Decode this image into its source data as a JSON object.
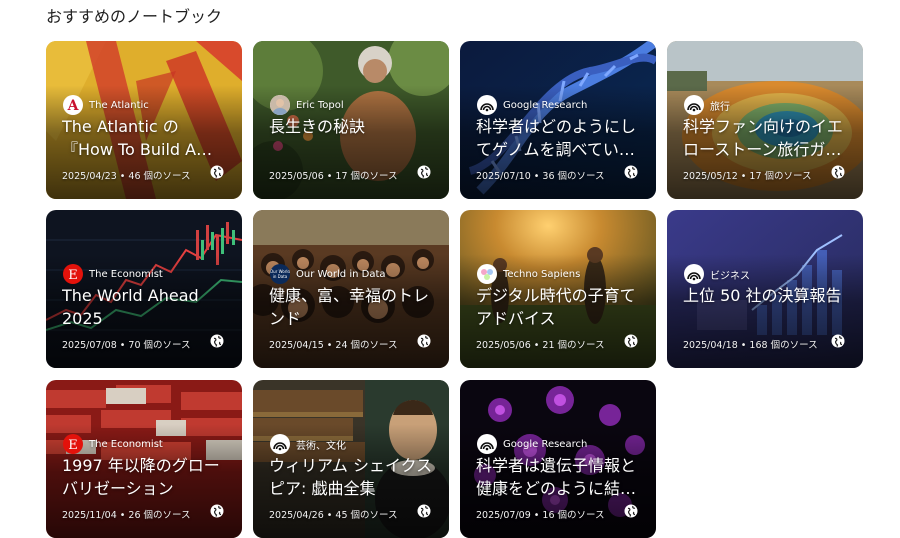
{
  "section": {
    "title": "おすすめのノートブック"
  },
  "notebooks": [
    {
      "source": "The Atlantic",
      "source_icon": "atlantic-logo-icon",
      "title": "The Atlantic の『How To Build A Life』",
      "date": "2025/04/23",
      "sources": "46 個のソース"
    },
    {
      "source": "Eric Topol",
      "source_icon": "avatar-icon",
      "title": "長生きの秘訣",
      "date": "2025/05/06",
      "sources": "17 個のソース"
    },
    {
      "source": "Google Research",
      "source_icon": "notebook-logo-icon",
      "title": "科学者はどのようにしてゲノムを調べているか",
      "date": "2025/07/10",
      "sources": "36 個のソース"
    },
    {
      "source": "旅行",
      "source_icon": "notebook-logo-icon",
      "title": "科学ファン向けのイエローストーン旅行ガイド",
      "date": "2025/05/12",
      "sources": "17 個のソース"
    },
    {
      "source": "The Economist",
      "source_icon": "economist-logo-icon",
      "title": "The World Ahead 2025",
      "date": "2025/07/08",
      "sources": "70 個のソース"
    },
    {
      "source": "Our World in Data",
      "source_icon": "owid-logo-icon",
      "title": "健康、富、幸福のトレンド",
      "date": "2025/04/15",
      "sources": "24 個のソース"
    },
    {
      "source": "Techno Sapiens",
      "source_icon": "techno-sapiens-logo-icon",
      "title": "デジタル時代の子育てアドバイス",
      "date": "2025/05/06",
      "sources": "21 個のソース"
    },
    {
      "source": "ビジネス",
      "source_icon": "notebook-logo-icon",
      "title": "上位 50 社の決算報告",
      "date": "2025/04/18",
      "sources": "168 個のソース"
    },
    {
      "source": "The Economist",
      "source_icon": "economist-logo-icon",
      "title": "1997 年以降のグローバリゼーション",
      "date": "2025/11/04",
      "sources": "26 個のソース"
    },
    {
      "source": "芸術、文化",
      "source_icon": "notebook-logo-icon",
      "title": "ウィリアム シェイクスピア: 戯曲全集",
      "date": "2025/04/26",
      "sources": "45 個のソース"
    },
    {
      "source": "Google Research",
      "source_icon": "notebook-logo-icon",
      "title": "科学者は遺伝子情報と健康をどのように結びつけているか",
      "date": "2025/07/09",
      "sources": "16 個のソース"
    }
  ],
  "meta_separator": " • ",
  "public_icon": "globe-icon"
}
